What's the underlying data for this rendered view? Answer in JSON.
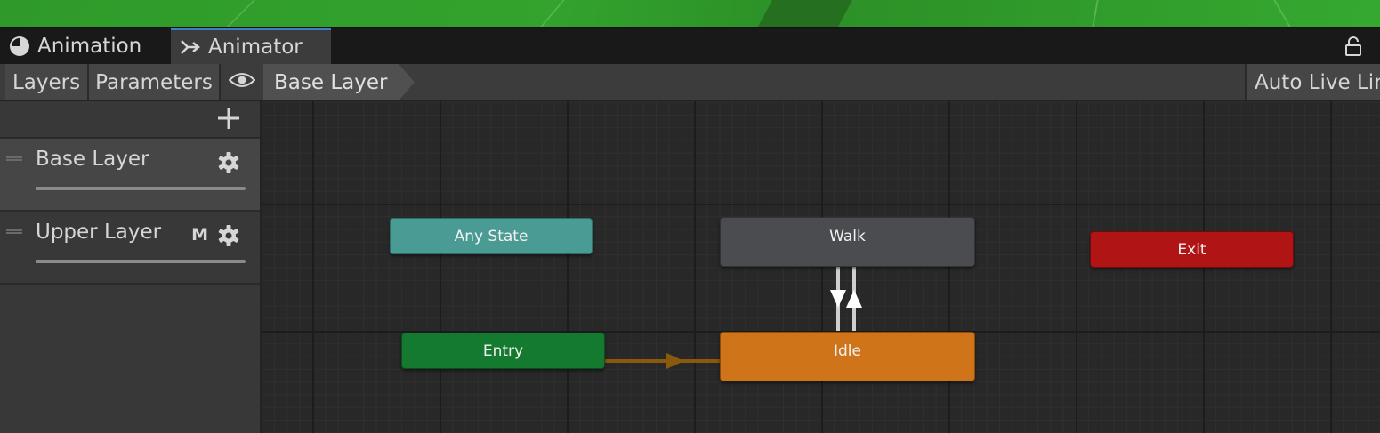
{
  "tabs": [
    {
      "label": "Animation",
      "icon": "clock-icon"
    },
    {
      "label": "Animator",
      "icon": "animator-icon"
    }
  ],
  "toolbar": {
    "layers_label": "Layers",
    "parameters_label": "Parameters",
    "breadcrumb": "Base Layer",
    "auto_live_link": "Auto Live Lin"
  },
  "layers": [
    {
      "name": "Base Layer",
      "flag": "",
      "selected": true
    },
    {
      "name": "Upper Layer",
      "flag": "M",
      "selected": false
    }
  ],
  "graph": {
    "nodes": {
      "any_state": "Any State",
      "walk": "Walk",
      "exit": "Exit",
      "entry": "Entry",
      "idle": "Idle"
    }
  },
  "colors": {
    "any_state": "#4a9b93",
    "walk": "#4b4c50",
    "exit": "#b01414",
    "entry": "#147a30",
    "idle": "#d07419",
    "transition_default": "#8a5a0c",
    "tab_accent": "#3d7ec9"
  }
}
